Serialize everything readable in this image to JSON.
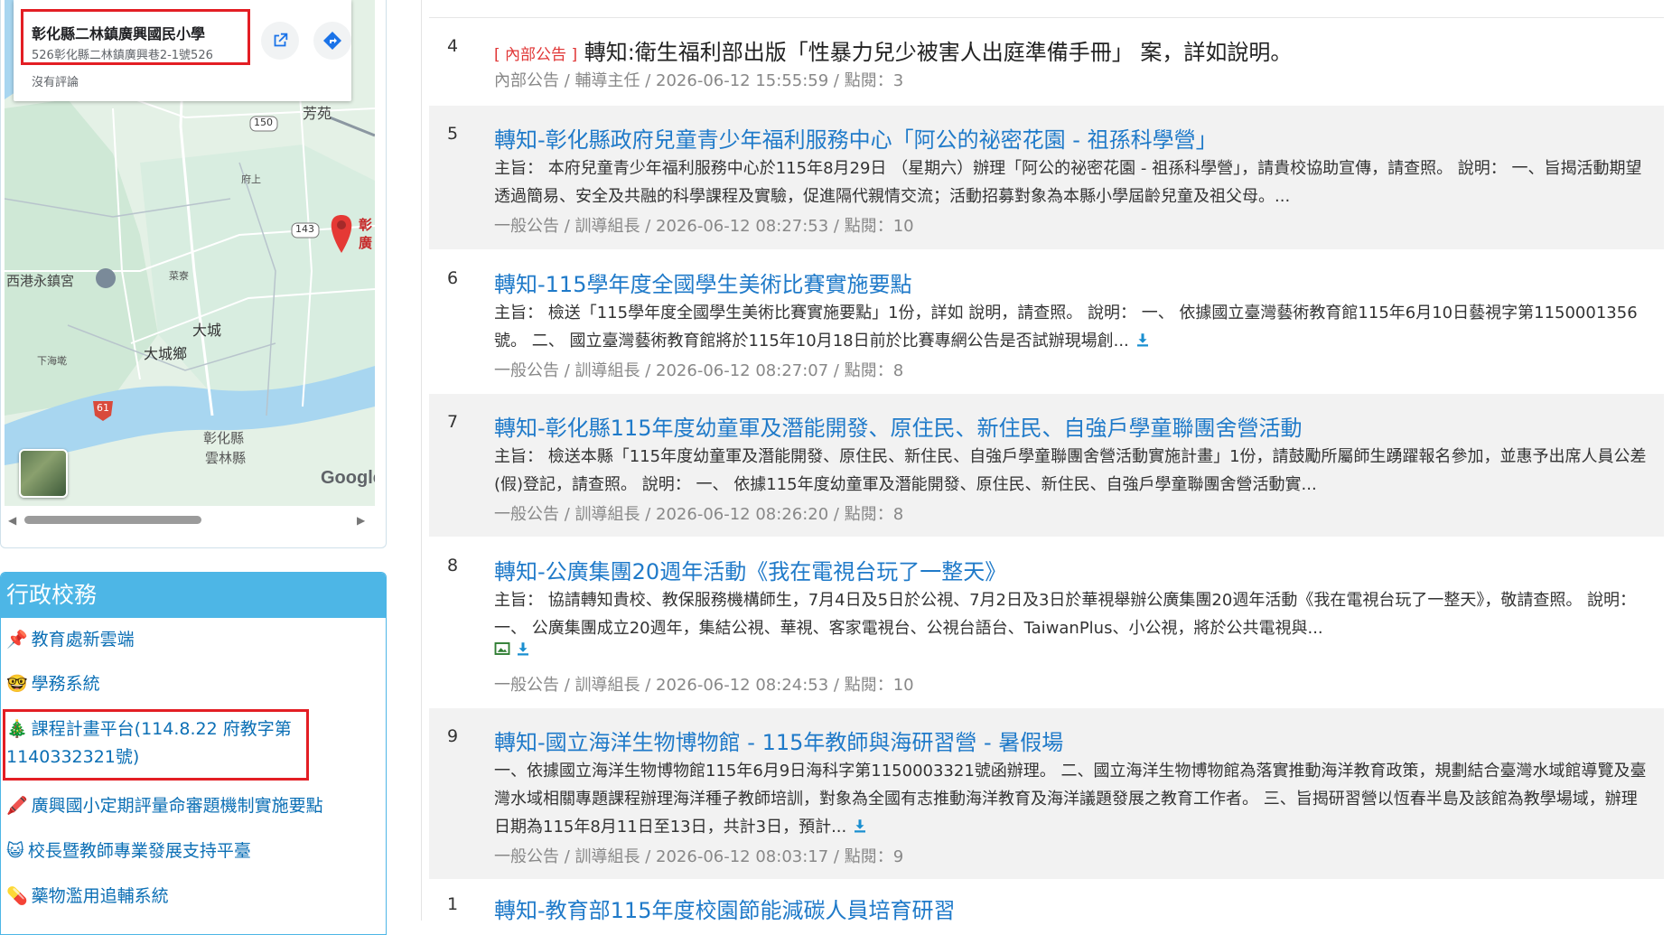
{
  "map": {
    "place_name": "彰化縣二林鎮廣興國民小學",
    "place_address": "526彰化縣二林鎮廣興巷2-1號526",
    "reviews": "沒有評論",
    "labels": {
      "fangyuan": "芳苑",
      "road150": "150",
      "road143": "143",
      "road61": "61",
      "fushang": "府上",
      "caiyao": "菜寮",
      "xigang": "西港永鎮宮",
      "dacheng": "大城",
      "dachengxiang": "大城鄉",
      "xiahailiao": "下海墘",
      "changhua": "彰化縣",
      "yunlin": "雲林縣",
      "pin_label1": "彰",
      "pin_label2": "廣"
    },
    "google": "Google"
  },
  "admin": {
    "title": "行政校務",
    "links": [
      {
        "emoji": "📌",
        "label": "教育處新雲端"
      },
      {
        "emoji": "🤓",
        "label": "學務系統"
      },
      {
        "emoji": "🎄",
        "label": "課程計畫平台(114.8.22 府教字第1140332321號)"
      },
      {
        "emoji": "🖍️",
        "label": "廣興國小定期評量命審題機制實施要點"
      },
      {
        "emoji": "😺",
        "label": "校長暨教師專業發展支持平臺"
      },
      {
        "emoji": "💊",
        "label": "藥物濫用追輔系統"
      }
    ]
  },
  "announcements": [
    {
      "num": "4",
      "tag": "[ 內部公告 ]",
      "title": "轉知:衛生福利部出版「性暴力兒少被害人出庭準備手冊」 案，詳如說明。",
      "body": "",
      "meta": "內部公告 / 輔導主任 / 2026-06-12 15:55:59 / 點閱：3"
    },
    {
      "num": "5",
      "tag": "",
      "title": "轉知-彰化縣政府兒童青少年福利服務中心「阿公的祕密花園 - 祖孫科學營」",
      "body": "主旨： 本府兒童青少年福利服務中心於115年8月29日 （星期六）辦理「阿公的祕密花園 - 祖孫科學營」，請貴校協助宣傳，請查照。 說明： 一、旨揭活動期望透過簡易、安全及共融的科學課程及實驗，促進隔代親情交流；活動招募對象為本縣小學屆齡兒童及祖父母。...",
      "meta": "一般公告 / 訓導組長 / 2026-06-12 08:27:53 / 點閱：10"
    },
    {
      "num": "6",
      "tag": "",
      "title": "轉知-115學年度全國學生美術比賽實施要點",
      "body": "主旨： 檢送「115學年度全國學生美術比賽實施要點」1份，詳如 說明，請查照。 說明： 一、 依據國立臺灣藝術教育館115年6月10日藝視字第1150001356號。 二、 國立臺灣藝術教育館將於115年10月18日前於比賽專網公告是否試辦現場創...",
      "meta": "一般公告 / 訓導組長 / 2026-06-12 08:27:07 / 點閱：8"
    },
    {
      "num": "7",
      "tag": "",
      "title": "轉知-彰化縣115年度幼童軍及潛能開發、原住民、新住民、自強戶學童聯團舍營活動",
      "body": "主旨： 檢送本縣「115年度幼童軍及潛能開發、原住民、新住民、自強戶學童聯團舍營活動實施計畫」1份，請鼓勵所屬師生踴躍報名參加，並惠予出席人員公差(假)登記，請查照。 說明： 一、 依據115年度幼童軍及潛能開發、原住民、新住民、自強戶學童聯團舍營活動實...",
      "meta": "一般公告 / 訓導組長 / 2026-06-12 08:26:20 / 點閱：8"
    },
    {
      "num": "8",
      "tag": "",
      "title": "轉知-公廣集團20週年活動《我在電視台玩了一整天》",
      "body": "主旨： 協請轉知貴校、教保服務機構師生，7月4日及5日於公視、7月2日及3日於華視舉辦公廣集團20週年活動《我在電視台玩了一整天》，敬請查照。 說明： 一、 公廣集團成立20週年，集結公視、華視、客家電視台、公視台語台、TaiwanPlus、小公視，將於公共電視與...",
      "meta": "一般公告 / 訓導組長 / 2026-06-12 08:24:53 / 點閱：10"
    },
    {
      "num": "9",
      "tag": "",
      "title": "轉知-國立海洋生物博物館 - 115年教師與海研習營 - 暑假場",
      "body": "一、依據國立海洋生物博物館115年6月9日海科字第1150003321號函辦理。 二、國立海洋生物博物館為落實推動海洋教育政策，規劃結合臺灣水域館導覽及臺灣水域相關專題課程辦理海洋種子教師培訓，對象為全國有志推動海洋教育及海洋議題發展之教育工作者。 三、旨揭研習營以恆春半島及該館為教學場域，辦理日期為115年8月11日至13日，共計3日，預計...",
      "meta": "一般公告 / 訓導組長 / 2026-06-12 08:03:17 / 點閱：9"
    },
    {
      "num": "1",
      "tag": "",
      "title": "轉知-教育部115年度校園節能減碳人員培育研習",
      "body": "",
      "meta": ""
    }
  ],
  "colors": {
    "link": "#1f7ac9",
    "accent": "#4db6e6",
    "highlight": "#e31e24",
    "download": "#1a8fd0"
  }
}
